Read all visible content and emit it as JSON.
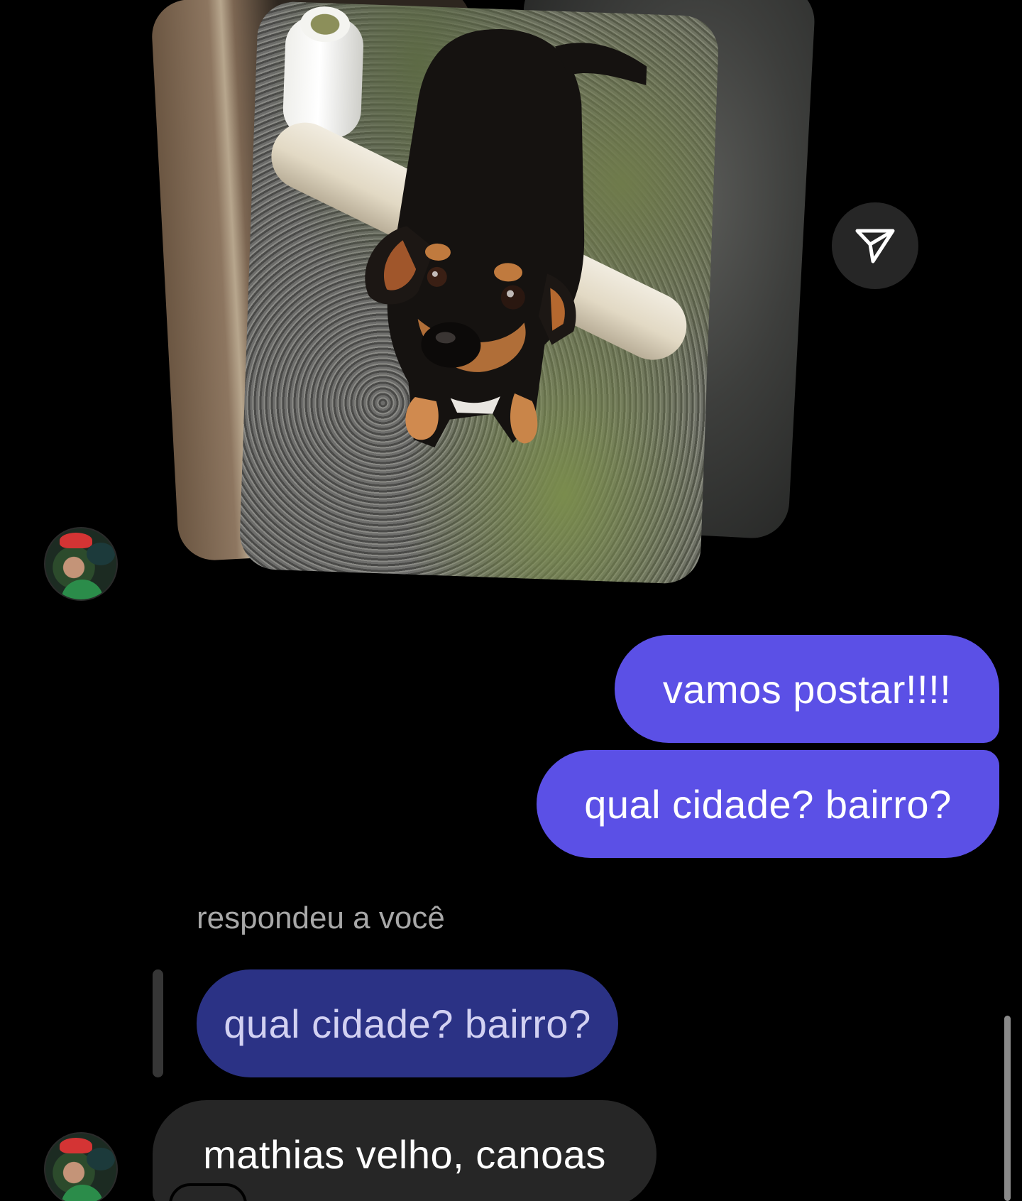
{
  "thread": {
    "shared_post": {
      "image_description_icon": "dog-photo-carousel",
      "share_icon": "paper-plane-icon"
    },
    "messages": [
      {
        "sender": "me",
        "text": "vamos postar!!!!"
      },
      {
        "sender": "me",
        "text": "qual cidade? bairro?"
      }
    ],
    "reply": {
      "label": "respondeu a você",
      "quoted_text": "qual cidade? bairro?",
      "text": "mathias velho, canoas"
    }
  },
  "colors": {
    "sent_bubble": "#5b50e6",
    "quoted_bubble": "#2b3285",
    "received_bubble": "#262626",
    "background": "#000000"
  }
}
